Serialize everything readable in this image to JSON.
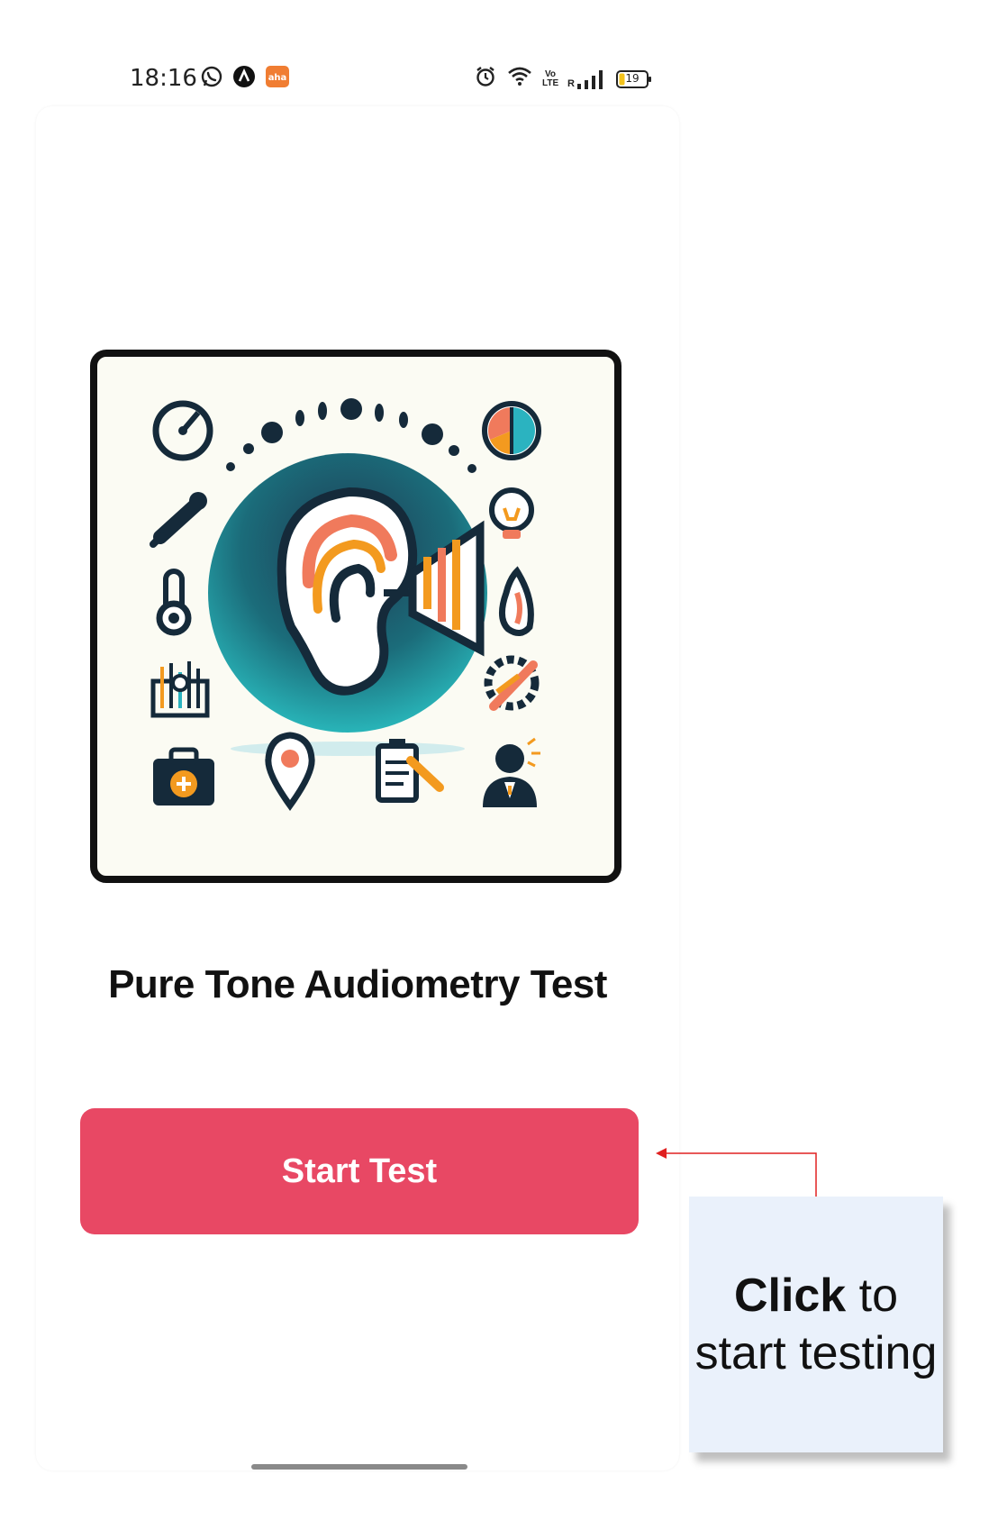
{
  "status_bar": {
    "time": "18:16",
    "left_icons": [
      "whatsapp-icon",
      "app-a-icon",
      "aha-icon"
    ],
    "aha_label": "aha",
    "right_icons": [
      "alarm-icon",
      "wifi-icon",
      "volte-icon",
      "signal-icon",
      "battery-icon"
    ],
    "volte_label": "Vo LTE",
    "signal_label": "R",
    "battery_level": "19"
  },
  "main": {
    "title": "Pure Tone Audiometry Test",
    "start_button_label": "Start Test",
    "hero_image_alt": "ear with speaker icon surrounded by medical icons"
  },
  "annotation": {
    "emphasis": "Click",
    "rest": " to start testing"
  },
  "colors": {
    "primary_button": "#e84864",
    "callout_background": "#eaf1fb",
    "arrow": "#e02020"
  }
}
